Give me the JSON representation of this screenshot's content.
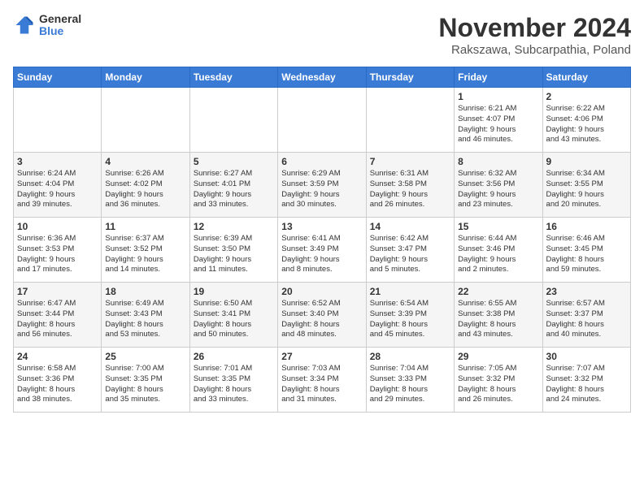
{
  "logo": {
    "general": "General",
    "blue": "Blue"
  },
  "title": "November 2024",
  "location": "Rakszawa, Subcarpathia, Poland",
  "headers": [
    "Sunday",
    "Monday",
    "Tuesday",
    "Wednesday",
    "Thursday",
    "Friday",
    "Saturday"
  ],
  "weeks": [
    [
      {
        "day": "",
        "info": ""
      },
      {
        "day": "",
        "info": ""
      },
      {
        "day": "",
        "info": ""
      },
      {
        "day": "",
        "info": ""
      },
      {
        "day": "",
        "info": ""
      },
      {
        "day": "1",
        "info": "Sunrise: 6:21 AM\nSunset: 4:07 PM\nDaylight: 9 hours\nand 46 minutes."
      },
      {
        "day": "2",
        "info": "Sunrise: 6:22 AM\nSunset: 4:06 PM\nDaylight: 9 hours\nand 43 minutes."
      }
    ],
    [
      {
        "day": "3",
        "info": "Sunrise: 6:24 AM\nSunset: 4:04 PM\nDaylight: 9 hours\nand 39 minutes."
      },
      {
        "day": "4",
        "info": "Sunrise: 6:26 AM\nSunset: 4:02 PM\nDaylight: 9 hours\nand 36 minutes."
      },
      {
        "day": "5",
        "info": "Sunrise: 6:27 AM\nSunset: 4:01 PM\nDaylight: 9 hours\nand 33 minutes."
      },
      {
        "day": "6",
        "info": "Sunrise: 6:29 AM\nSunset: 3:59 PM\nDaylight: 9 hours\nand 30 minutes."
      },
      {
        "day": "7",
        "info": "Sunrise: 6:31 AM\nSunset: 3:58 PM\nDaylight: 9 hours\nand 26 minutes."
      },
      {
        "day": "8",
        "info": "Sunrise: 6:32 AM\nSunset: 3:56 PM\nDaylight: 9 hours\nand 23 minutes."
      },
      {
        "day": "9",
        "info": "Sunrise: 6:34 AM\nSunset: 3:55 PM\nDaylight: 9 hours\nand 20 minutes."
      }
    ],
    [
      {
        "day": "10",
        "info": "Sunrise: 6:36 AM\nSunset: 3:53 PM\nDaylight: 9 hours\nand 17 minutes."
      },
      {
        "day": "11",
        "info": "Sunrise: 6:37 AM\nSunset: 3:52 PM\nDaylight: 9 hours\nand 14 minutes."
      },
      {
        "day": "12",
        "info": "Sunrise: 6:39 AM\nSunset: 3:50 PM\nDaylight: 9 hours\nand 11 minutes."
      },
      {
        "day": "13",
        "info": "Sunrise: 6:41 AM\nSunset: 3:49 PM\nDaylight: 9 hours\nand 8 minutes."
      },
      {
        "day": "14",
        "info": "Sunrise: 6:42 AM\nSunset: 3:47 PM\nDaylight: 9 hours\nand 5 minutes."
      },
      {
        "day": "15",
        "info": "Sunrise: 6:44 AM\nSunset: 3:46 PM\nDaylight: 9 hours\nand 2 minutes."
      },
      {
        "day": "16",
        "info": "Sunrise: 6:46 AM\nSunset: 3:45 PM\nDaylight: 8 hours\nand 59 minutes."
      }
    ],
    [
      {
        "day": "17",
        "info": "Sunrise: 6:47 AM\nSunset: 3:44 PM\nDaylight: 8 hours\nand 56 minutes."
      },
      {
        "day": "18",
        "info": "Sunrise: 6:49 AM\nSunset: 3:43 PM\nDaylight: 8 hours\nand 53 minutes."
      },
      {
        "day": "19",
        "info": "Sunrise: 6:50 AM\nSunset: 3:41 PM\nDaylight: 8 hours\nand 50 minutes."
      },
      {
        "day": "20",
        "info": "Sunrise: 6:52 AM\nSunset: 3:40 PM\nDaylight: 8 hours\nand 48 minutes."
      },
      {
        "day": "21",
        "info": "Sunrise: 6:54 AM\nSunset: 3:39 PM\nDaylight: 8 hours\nand 45 minutes."
      },
      {
        "day": "22",
        "info": "Sunrise: 6:55 AM\nSunset: 3:38 PM\nDaylight: 8 hours\nand 43 minutes."
      },
      {
        "day": "23",
        "info": "Sunrise: 6:57 AM\nSunset: 3:37 PM\nDaylight: 8 hours\nand 40 minutes."
      }
    ],
    [
      {
        "day": "24",
        "info": "Sunrise: 6:58 AM\nSunset: 3:36 PM\nDaylight: 8 hours\nand 38 minutes."
      },
      {
        "day": "25",
        "info": "Sunrise: 7:00 AM\nSunset: 3:35 PM\nDaylight: 8 hours\nand 35 minutes."
      },
      {
        "day": "26",
        "info": "Sunrise: 7:01 AM\nSunset: 3:35 PM\nDaylight: 8 hours\nand 33 minutes."
      },
      {
        "day": "27",
        "info": "Sunrise: 7:03 AM\nSunset: 3:34 PM\nDaylight: 8 hours\nand 31 minutes."
      },
      {
        "day": "28",
        "info": "Sunrise: 7:04 AM\nSunset: 3:33 PM\nDaylight: 8 hours\nand 29 minutes."
      },
      {
        "day": "29",
        "info": "Sunrise: 7:05 AM\nSunset: 3:32 PM\nDaylight: 8 hours\nand 26 minutes."
      },
      {
        "day": "30",
        "info": "Sunrise: 7:07 AM\nSunset: 3:32 PM\nDaylight: 8 hours\nand 24 minutes."
      }
    ]
  ]
}
